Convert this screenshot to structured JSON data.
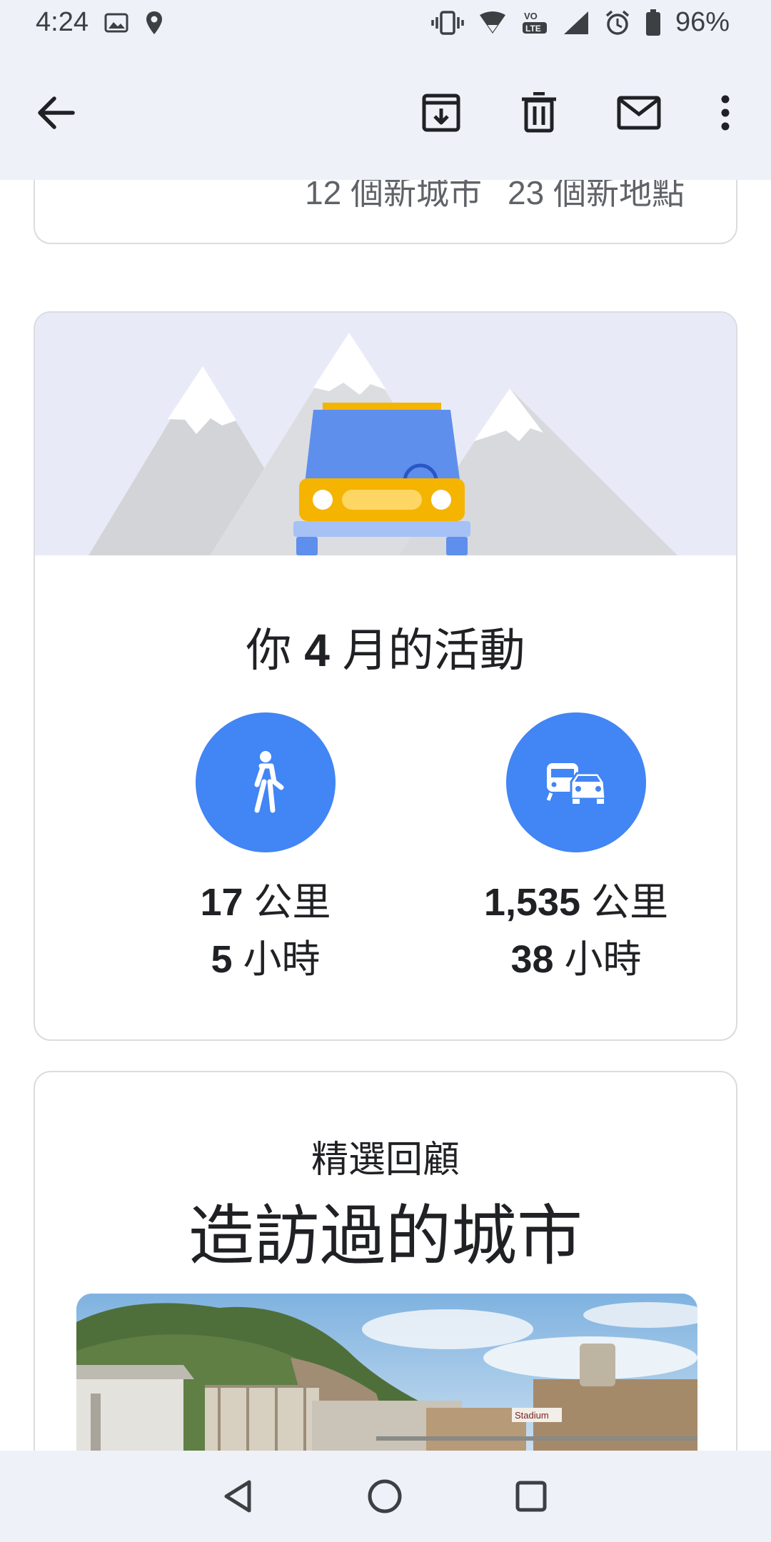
{
  "status_bar": {
    "time": "4:24",
    "battery": "96%",
    "icons": [
      "image-icon",
      "location-icon",
      "vibrate-icon",
      "wifi-icon",
      "volte-icon",
      "signal-icon",
      "alarm-icon",
      "battery-icon"
    ]
  },
  "app_bar": {
    "icons": [
      "back-arrow-icon",
      "archive-icon",
      "delete-icon",
      "mail-icon",
      "more-icon"
    ]
  },
  "summary_card": {
    "cities": "12 個新城市",
    "places": "23 個新地點"
  },
  "activity_card": {
    "title_pre": "你 ",
    "title_month": "4",
    "title_post": " 月的活動",
    "walking": {
      "icon": "walk-icon",
      "distance_value": "17",
      "distance_unit": " 公里",
      "time_value": "5",
      "time_unit": " 小時"
    },
    "driving": {
      "icon": "transit-car-icon",
      "distance_value": "1,535",
      "distance_unit": " 公里",
      "time_value": "38",
      "time_unit": " 小時"
    }
  },
  "highlights_card": {
    "subtitle": "精選回顧",
    "title": "造訪過的城市",
    "photo_sign": "Stadium"
  },
  "nav_bar": {
    "icons": [
      "back-triangle-icon",
      "home-circle-icon",
      "recents-square-icon"
    ]
  },
  "colors": {
    "chrome": "#eef1f8",
    "accent": "#4285f4",
    "card_border": "#dadce0"
  }
}
